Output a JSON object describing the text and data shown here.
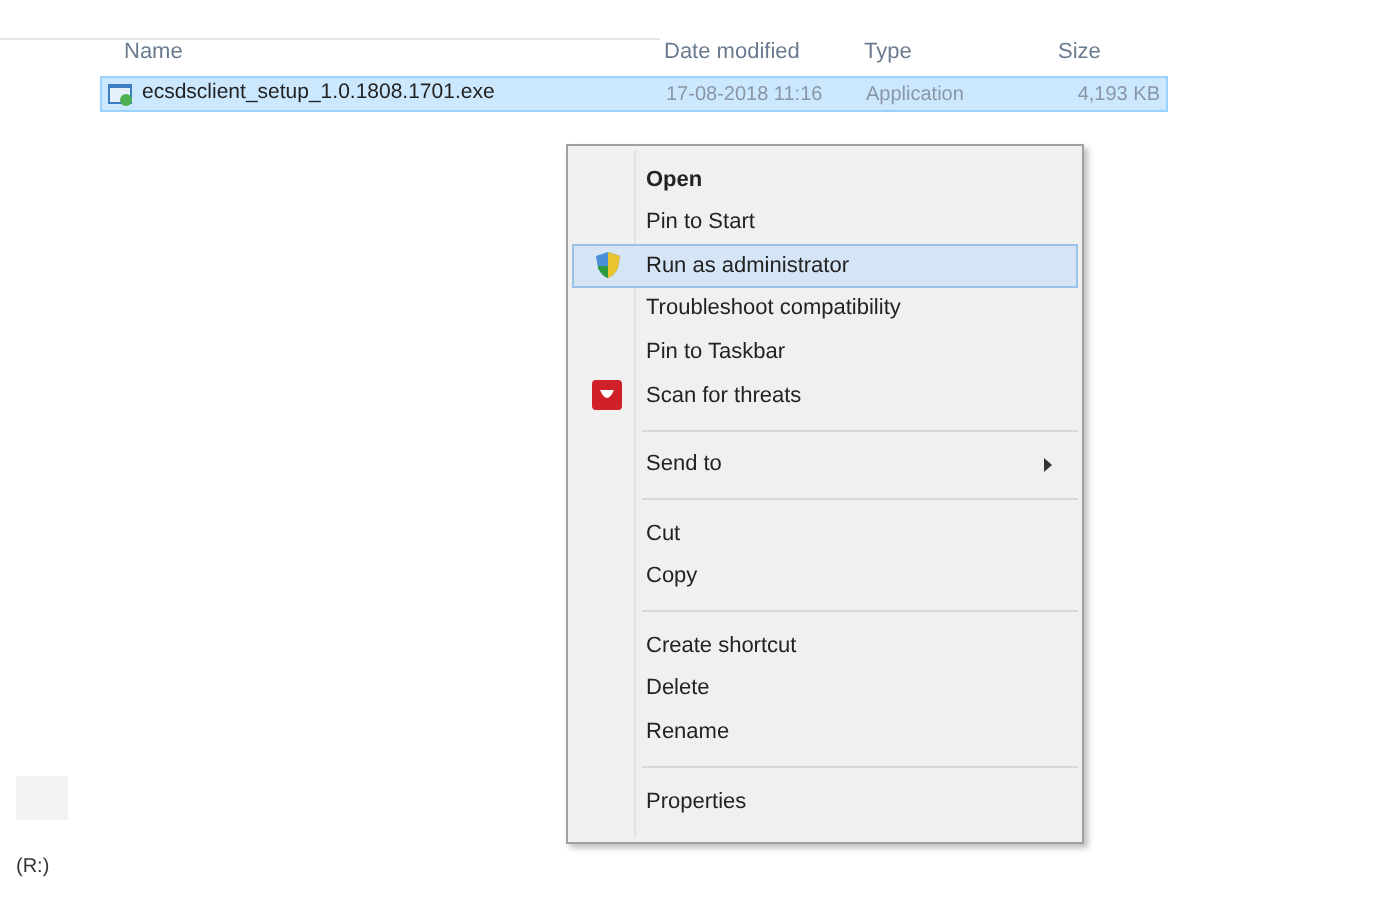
{
  "columns": [
    {
      "label": "Name"
    },
    {
      "label": "Date modified"
    },
    {
      "label": "Type"
    },
    {
      "label": "Size"
    }
  ],
  "file": {
    "name": "ecsdsclient_setup_1.0.1808.1701.exe",
    "date": "17-08-2018 11:16",
    "type": "Application",
    "size": "4,193 KB",
    "selected": true
  },
  "context_menu": [
    {
      "kind": "item",
      "label": "Open",
      "bold": true,
      "selected": false
    },
    {
      "kind": "item",
      "label": "Pin to Start",
      "selected": false
    },
    {
      "kind": "shield",
      "label": "Run as administrator",
      "selected": true
    },
    {
      "kind": "item",
      "label": "Troubleshoot compatibility",
      "selected": false
    },
    {
      "kind": "item",
      "label": "Pin to Taskbar",
      "selected": false
    },
    {
      "kind": "antivirus",
      "label": "Scan for threats",
      "selected": false
    },
    {
      "kind": "separator"
    },
    {
      "kind": "submenu",
      "label": "Send to",
      "selected": false
    },
    {
      "kind": "separator"
    },
    {
      "kind": "item",
      "label": "Cut",
      "selected": false
    },
    {
      "kind": "item",
      "label": "Copy",
      "selected": false
    },
    {
      "kind": "separator"
    },
    {
      "kind": "item",
      "label": "Create shortcut",
      "selected": false
    },
    {
      "kind": "item",
      "label": "Delete",
      "selected": false
    },
    {
      "kind": "item",
      "label": "Rename",
      "selected": false
    },
    {
      "kind": "separator"
    },
    {
      "kind": "item",
      "label": "Properties",
      "selected": false
    }
  ],
  "drive_label": "(R:)"
}
